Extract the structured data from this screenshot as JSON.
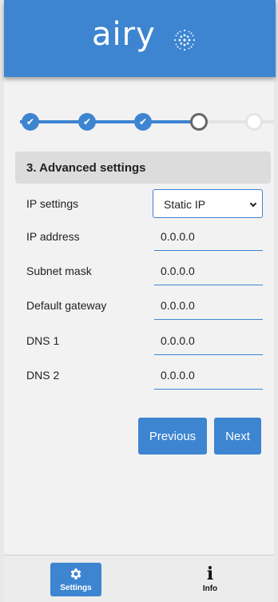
{
  "brand": {
    "name": "airy"
  },
  "colors": {
    "primary": "#3d85d1",
    "done_step": "#3d85d1",
    "current_step_border": "#666666",
    "future_step_border": "#e4e4e4"
  },
  "stepper": {
    "steps": [
      {
        "state": "done",
        "icon": "check-icon"
      },
      {
        "state": "done",
        "icon": "check-icon"
      },
      {
        "state": "done",
        "icon": "check-icon"
      },
      {
        "state": "current"
      },
      {
        "state": "future"
      }
    ]
  },
  "section": {
    "title": "3. Advanced settings"
  },
  "fields": {
    "ip_settings": {
      "label": "IP settings",
      "value": "Static IP"
    },
    "ip_address": {
      "label": "IP address",
      "value": "0.0.0.0"
    },
    "subnet_mask": {
      "label": "Subnet mask",
      "value": "0.0.0.0"
    },
    "default_gateway": {
      "label": "Default gateway",
      "value": "0.0.0.0"
    },
    "dns1": {
      "label": "DNS 1",
      "value": "0.0.0.0"
    },
    "dns2": {
      "label": "DNS 2",
      "value": "0.0.0.0"
    }
  },
  "buttons": {
    "previous": "Previous",
    "next": "Next"
  },
  "nav": {
    "settings": {
      "label": "Settings",
      "icon": "gear-icon"
    },
    "info": {
      "label": "Info",
      "icon": "info-icon"
    }
  }
}
